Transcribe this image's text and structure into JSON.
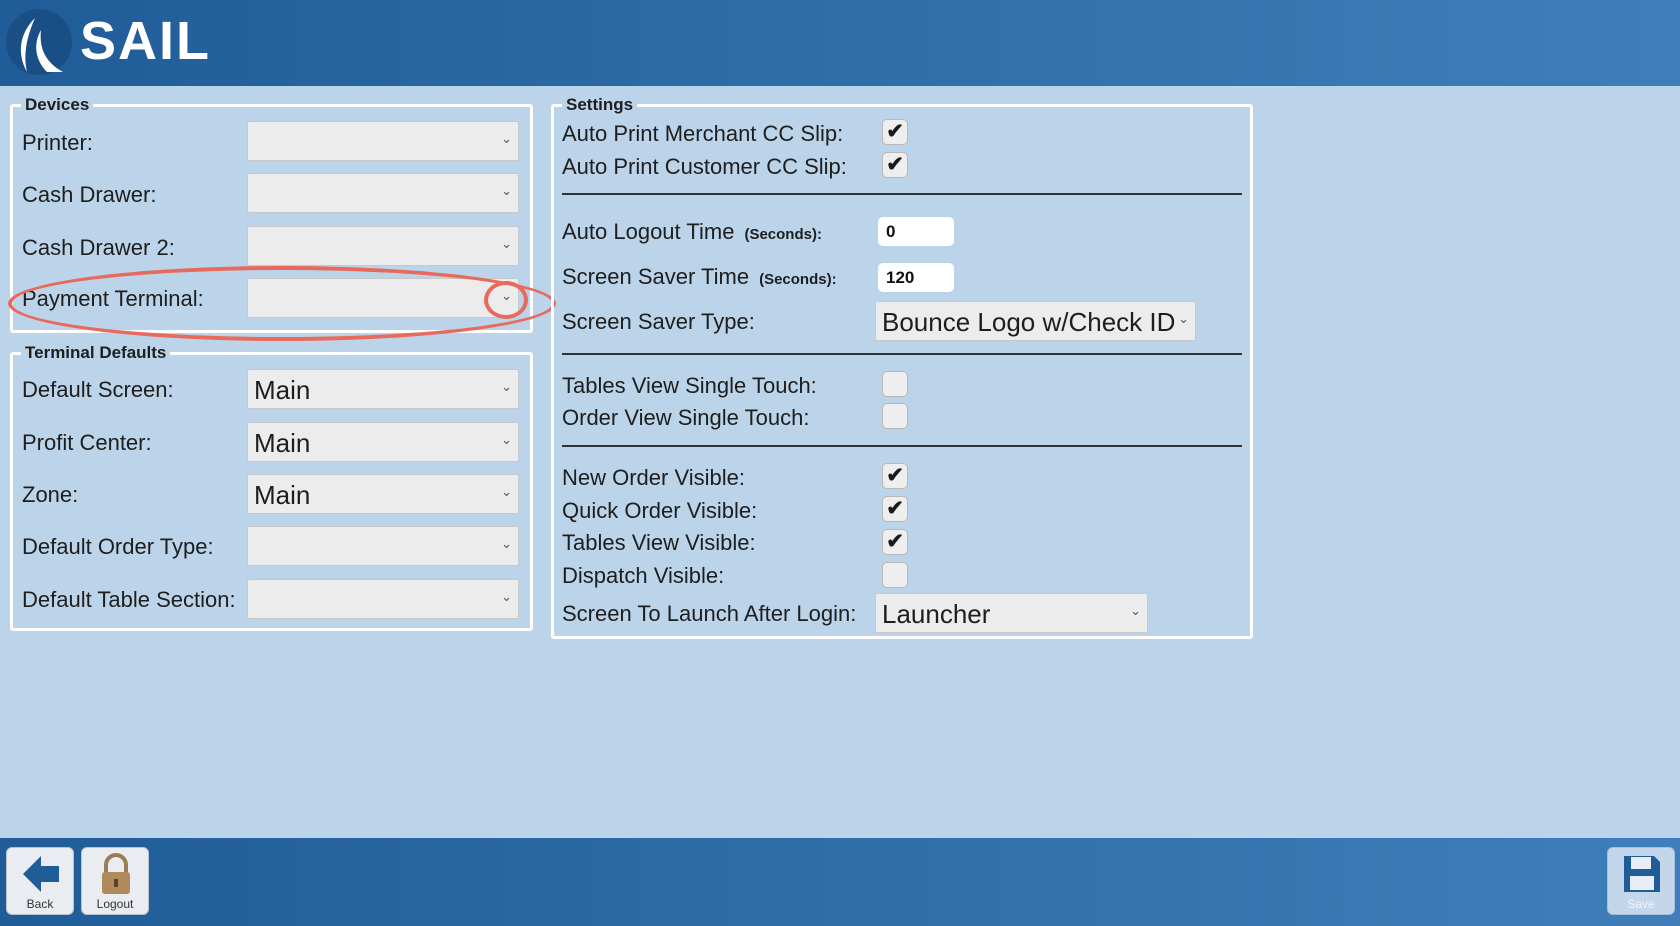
{
  "app": {
    "brand": "SAIL"
  },
  "devices": {
    "legend": "Devices",
    "rows": [
      {
        "label": "Printer:",
        "value": ""
      },
      {
        "label": "Cash Drawer:",
        "value": ""
      },
      {
        "label": "Cash Drawer 2:",
        "value": ""
      },
      {
        "label": "Payment Terminal:",
        "value": ""
      }
    ]
  },
  "terminal_defaults": {
    "legend": "Terminal Defaults",
    "rows": [
      {
        "label": "Default Screen:",
        "value": "Main"
      },
      {
        "label": "Profit Center:",
        "value": "Main"
      },
      {
        "label": "Zone:",
        "value": "Main"
      },
      {
        "label": "Default Order Type:",
        "value": ""
      },
      {
        "label": "Default Table Section:",
        "value": ""
      }
    ]
  },
  "settings": {
    "legend": "Settings",
    "auto_print_merchant": {
      "label": "Auto Print Merchant CC Slip:",
      "checked": true
    },
    "auto_print_customer": {
      "label": "Auto Print Customer CC Slip:",
      "checked": true
    },
    "auto_logout": {
      "label": "Auto Logout Time",
      "unit": "(Seconds):",
      "value": "0"
    },
    "screen_saver_time": {
      "label": "Screen Saver Time",
      "unit": "(Seconds):",
      "value": "120"
    },
    "screen_saver_type": {
      "label": "Screen Saver Type:",
      "value": "Bounce Logo w/Check ID"
    },
    "tables_view_single_touch": {
      "label": "Tables View Single Touch:",
      "checked": false
    },
    "order_view_single_touch": {
      "label": "Order View Single Touch:",
      "checked": false
    },
    "new_order_visible": {
      "label": "New Order Visible:",
      "checked": true
    },
    "quick_order_visible": {
      "label": "Quick Order Visible:",
      "checked": true
    },
    "tables_view_visible": {
      "label": "Tables View Visible:",
      "checked": true
    },
    "dispatch_visible": {
      "label": "Dispatch Visible:",
      "checked": false
    },
    "screen_to_launch": {
      "label": "Screen To Launch After Login:",
      "value": "Launcher"
    }
  },
  "toolbar": {
    "back_label": "Back",
    "logout_label": "Logout",
    "save_label": "Save"
  },
  "icons": {
    "dropdown": "chevron-down-icon",
    "checkmark": "checkmark-icon",
    "back": "back-arrow-icon",
    "logout": "padlock-icon",
    "save": "floppy-disk-icon"
  },
  "colors": {
    "header_bar": "#2e6ca6",
    "page_background": "#bcd4e9",
    "annotation_ring": "#e76a5c"
  },
  "chev": "⌄",
  "check": "✔"
}
